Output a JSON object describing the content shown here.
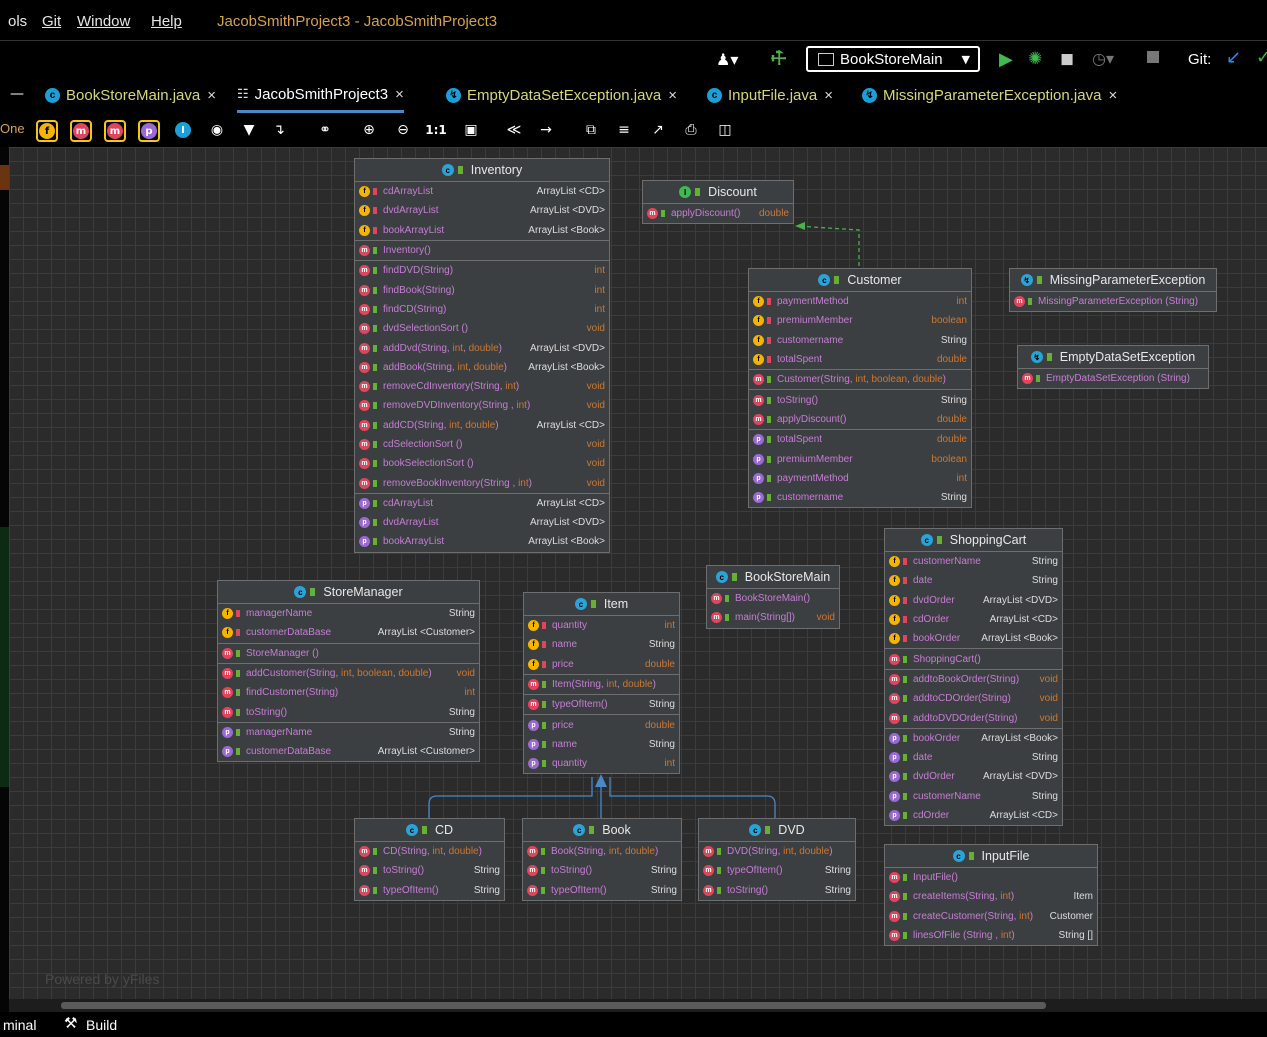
{
  "menubar": {
    "items": [
      "ols",
      "Git",
      "Window",
      "Help"
    ],
    "project_title": "JacobSmithProject3 - JacobSmithProject3"
  },
  "runbar": {
    "config": "BookStoreMain",
    "git_label": "Git:"
  },
  "tabs": [
    {
      "label": "BookStoreMain.java",
      "close": "×"
    },
    {
      "label": "JacobSmithProject3",
      "close": "×"
    },
    {
      "label": "EmptyDataSetException.java",
      "close": "×"
    },
    {
      "label": "InputFile.java",
      "close": "×"
    },
    {
      "label": "MissingParameterException.java",
      "close": "×"
    }
  ],
  "left_fragment": "One",
  "toolbar": {
    "ratio": "1:1"
  },
  "status": {
    "terminal": "minal",
    "build": "Build"
  },
  "watermark": "Powered by yFiles",
  "colors": {
    "background": "#2b2b2b",
    "node": "#3c3f41",
    "accent": "#4a88c7"
  },
  "classes": {
    "inventory": {
      "name": "Inventory",
      "fields": [
        {
          "name": "cdArrayList",
          "type": "ArrayList <CD>"
        },
        {
          "name": "dvdArrayList",
          "type": "ArrayList <DVD>"
        },
        {
          "name": "bookArrayList",
          "type": "ArrayList <Book>"
        }
      ],
      "constructors": [
        {
          "name": "Inventory()",
          "type": ""
        }
      ],
      "methods": [
        {
          "name": "findDVD(String)",
          "type": "int"
        },
        {
          "name": "findBook(String)",
          "type": "int"
        },
        {
          "name": "findCD(String)",
          "type": "int"
        },
        {
          "name": "dvdSelectionSort ()",
          "type": "void"
        },
        {
          "name": "addDvd(String, int, double)",
          "type": "ArrayList <DVD>"
        },
        {
          "name": "addBook(String, int, double)",
          "type": "ArrayList <Book>"
        },
        {
          "name": "removeCdInventory(String, int)",
          "type": "void"
        },
        {
          "name": "removeDVDInventory(String , int)",
          "type": "void"
        },
        {
          "name": "addCD(String, int, double)",
          "type": "ArrayList <CD>"
        },
        {
          "name": "cdSelectionSort ()",
          "type": "void"
        },
        {
          "name": "bookSelectionSort ()",
          "type": "void"
        },
        {
          "name": "removeBookInventory(String , int)",
          "type": "void"
        }
      ],
      "properties": [
        {
          "name": "cdArrayList",
          "type": "ArrayList <CD>"
        },
        {
          "name": "dvdArrayList",
          "type": "ArrayList <DVD>"
        },
        {
          "name": "bookArrayList",
          "type": "ArrayList <Book>"
        }
      ]
    },
    "discount": {
      "name": "Discount",
      "methods": [
        {
          "name": "applyDiscount()",
          "type": "double"
        }
      ]
    },
    "customer": {
      "name": "Customer",
      "fields": [
        {
          "name": "paymentMethod",
          "type": "int"
        },
        {
          "name": "premiumMember",
          "type": "boolean"
        },
        {
          "name": "customername",
          "type": "String"
        },
        {
          "name": "totalSpent",
          "type": "double"
        }
      ],
      "constructors": [
        {
          "name": "Customer(String, int, boolean, double)",
          "type": ""
        }
      ],
      "methods": [
        {
          "name": "toString()",
          "type": "String"
        },
        {
          "name": "applyDiscount()",
          "type": "double"
        }
      ],
      "properties": [
        {
          "name": "totalSpent",
          "type": "double"
        },
        {
          "name": "premiumMember",
          "type": "boolean"
        },
        {
          "name": "paymentMethod",
          "type": "int"
        },
        {
          "name": "customername",
          "type": "String"
        }
      ]
    },
    "missing_param": {
      "name": "MissingParameterException",
      "methods": [
        {
          "name": "MissingParameterException (String)",
          "type": ""
        }
      ]
    },
    "empty_data": {
      "name": "EmptyDataSetException",
      "methods": [
        {
          "name": "EmptyDataSetException (String)",
          "type": ""
        }
      ]
    },
    "store_manager": {
      "name": "StoreManager",
      "fields": [
        {
          "name": "managerName",
          "type": "String"
        },
        {
          "name": "customerDataBase",
          "type": "ArrayList <Customer>"
        }
      ],
      "constructors": [
        {
          "name": "StoreManager ()",
          "type": ""
        }
      ],
      "methods": [
        {
          "name": "addCustomer(String, int, boolean, double)",
          "type": "void"
        },
        {
          "name": "findCustomer(String)",
          "type": "int"
        },
        {
          "name": "toString()",
          "type": "String"
        }
      ],
      "properties": [
        {
          "name": "managerName",
          "type": "String"
        },
        {
          "name": "customerDataBase",
          "type": "ArrayList <Customer>"
        }
      ]
    },
    "item": {
      "name": "Item",
      "fields": [
        {
          "name": "quantity",
          "type": "int"
        },
        {
          "name": "name",
          "type": "String"
        },
        {
          "name": "price",
          "type": "double"
        }
      ],
      "constructors": [
        {
          "name": "Item(String, int, double)",
          "type": ""
        }
      ],
      "methods": [
        {
          "name": "typeOfItem()",
          "type": "String"
        }
      ],
      "properties": [
        {
          "name": "price",
          "type": "double"
        },
        {
          "name": "name",
          "type": "String"
        },
        {
          "name": "quantity",
          "type": "int"
        }
      ]
    },
    "bookstore_main": {
      "name": "BookStoreMain",
      "methods": [
        {
          "name": "BookStoreMain()",
          "type": ""
        },
        {
          "name": "main(String[])",
          "type": "void"
        }
      ]
    },
    "shopping_cart": {
      "name": "ShoppingCart",
      "fields": [
        {
          "name": "customerName",
          "type": "String"
        },
        {
          "name": "date",
          "type": "String"
        },
        {
          "name": "dvdOrder",
          "type": "ArrayList <DVD>"
        },
        {
          "name": "cdOrder",
          "type": "ArrayList <CD>"
        },
        {
          "name": "bookOrder",
          "type": "ArrayList <Book>"
        }
      ],
      "constructors": [
        {
          "name": "ShoppingCart()",
          "type": ""
        }
      ],
      "methods": [
        {
          "name": "addtoBookOrder(String)",
          "type": "void"
        },
        {
          "name": "addtoCDOrder(String)",
          "type": "void"
        },
        {
          "name": "addtoDVDOrder(String)",
          "type": "void"
        }
      ],
      "properties": [
        {
          "name": "bookOrder",
          "type": "ArrayList <Book>"
        },
        {
          "name": "date",
          "type": "String"
        },
        {
          "name": "dvdOrder",
          "type": "ArrayList <DVD>"
        },
        {
          "name": "customerName",
          "type": "String"
        },
        {
          "name": "cdOrder",
          "type": "ArrayList <CD>"
        }
      ]
    },
    "cd": {
      "name": "CD",
      "methods": [
        {
          "name": "CD(String, int, double)",
          "type": ""
        },
        {
          "name": "toString()",
          "type": "String"
        },
        {
          "name": "typeOfItem()",
          "type": "String"
        }
      ]
    },
    "book": {
      "name": "Book",
      "methods": [
        {
          "name": "Book(String, int, double)",
          "type": ""
        },
        {
          "name": "toString()",
          "type": "String"
        },
        {
          "name": "typeOfItem()",
          "type": "String"
        }
      ]
    },
    "dvd": {
      "name": "DVD",
      "methods": [
        {
          "name": "DVD(String, int, double)",
          "type": ""
        },
        {
          "name": "typeOfItem()",
          "type": "String"
        },
        {
          "name": "toString()",
          "type": "String"
        }
      ]
    },
    "input_file": {
      "name": "InputFile",
      "methods": [
        {
          "name": "InputFile()",
          "type": ""
        },
        {
          "name": "createItems(String, int)",
          "type": "Item"
        },
        {
          "name": "createCustomer(String, int)",
          "type": "Customer"
        },
        {
          "name": "linesOfFile (String , int)",
          "type": "String []"
        }
      ]
    }
  }
}
